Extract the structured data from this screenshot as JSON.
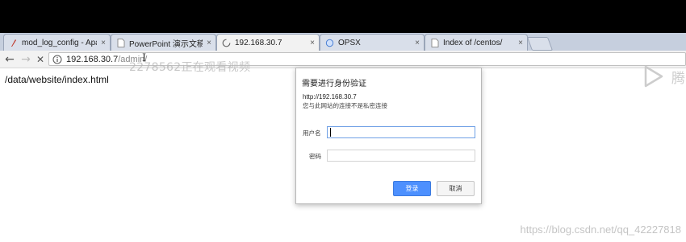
{
  "tabs": [
    {
      "title": "mod_log_config - Apa",
      "icon": "apache-feather-icon",
      "close": "×"
    },
    {
      "title": "PowerPoint 演示文稿",
      "icon": "document-icon",
      "close": "×"
    },
    {
      "title": "192.168.30.7",
      "icon": "loading-spinner-icon",
      "close": "×"
    },
    {
      "title": "OPSX",
      "icon": "globe-icon",
      "close": "×"
    },
    {
      "title": "Index of /centos/",
      "icon": "document-icon",
      "close": "×"
    }
  ],
  "navigation": {
    "back": "←",
    "forward": "→",
    "stop": "✕"
  },
  "address_bar": {
    "host": "192.168.30.7",
    "path": "/admin/"
  },
  "page": {
    "text": "/data/website/index.html"
  },
  "overlay": {
    "watermark_top": "2278562正在观看视频",
    "watermark_bottom": "https://blog.csdn.net/qq_42227818",
    "logo_char": "腾"
  },
  "auth_dialog": {
    "title": "需要进行身份验证",
    "url": "http://192.168.30.7",
    "warning": "您与此网站的连接不是私密连接",
    "username_label": "用户名",
    "username_value": "",
    "password_label": "密码",
    "password_value": "",
    "login_button": "登录",
    "cancel_button": "取消"
  },
  "colors": {
    "login_button": "#4d90fe",
    "tab_strip": "#c6cfde"
  }
}
